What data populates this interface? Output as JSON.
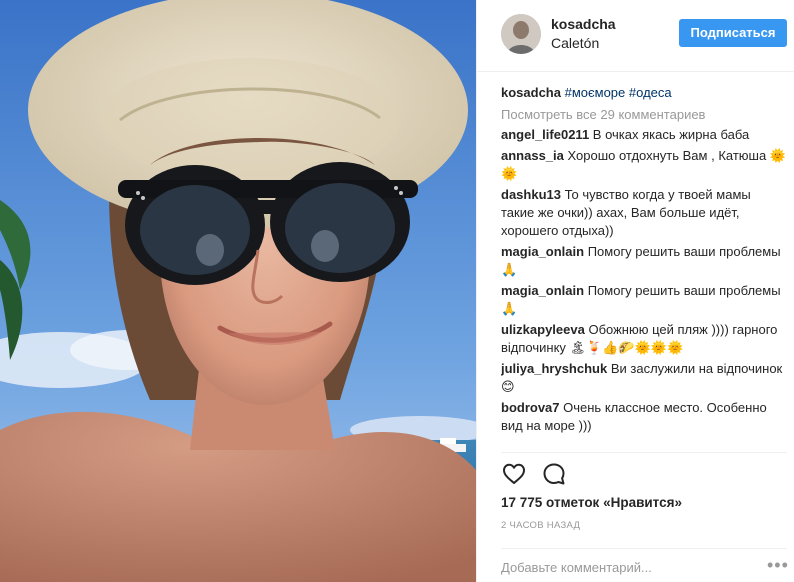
{
  "post": {
    "username": "kosadcha",
    "location": "Caletón",
    "follow_label": "Подписаться",
    "caption": {
      "username": "kosadcha",
      "hashtags": [
        "#моєморе",
        "#одеса"
      ]
    },
    "view_all_comments": "Посмотреть все 29 комментариев",
    "comments": [
      {
        "username": "angel_life0211",
        "text": "В очках якась жирна баба"
      },
      {
        "username": "annass_ia",
        "text": "Хорошо отдохнуть Вам , Катюша 🌞🌞"
      },
      {
        "username": "dashku13",
        "text": "То чувство когда у твоей мамы такие же очки)) ахах, Вам больше идёт, хорошего отдыха))"
      },
      {
        "username": "magia_onlain",
        "text": "Помогу решить ваши проблемы🙏"
      },
      {
        "username": "magia_onlain",
        "text": "Помогу решить ваши проблемы🙏"
      },
      {
        "username": "ulizkapyleeva",
        "text": "Обожнюю цей пляж )))) гарного відпочинку 🏝🍹👍🌮🌞🌞🌞"
      },
      {
        "username": "juliya_hryshchuk",
        "text": "Ви заслужили на відпочинок😊"
      },
      {
        "username": "bodrova7",
        "text": "Очень классное место. Особенно вид на море )))"
      }
    ],
    "likes": "17 775 отметок «Нравится»",
    "time_ago": "2 ЧАСОВ НАЗАД",
    "add_comment_placeholder": "Добавьте комментарий...",
    "more_options": "•••",
    "icons": {
      "like": "heart-outline-icon",
      "comment": "speech-bubble-icon"
    },
    "colors": {
      "accent": "#3897f0",
      "hashtag": "#003569",
      "muted": "#999999"
    }
  }
}
